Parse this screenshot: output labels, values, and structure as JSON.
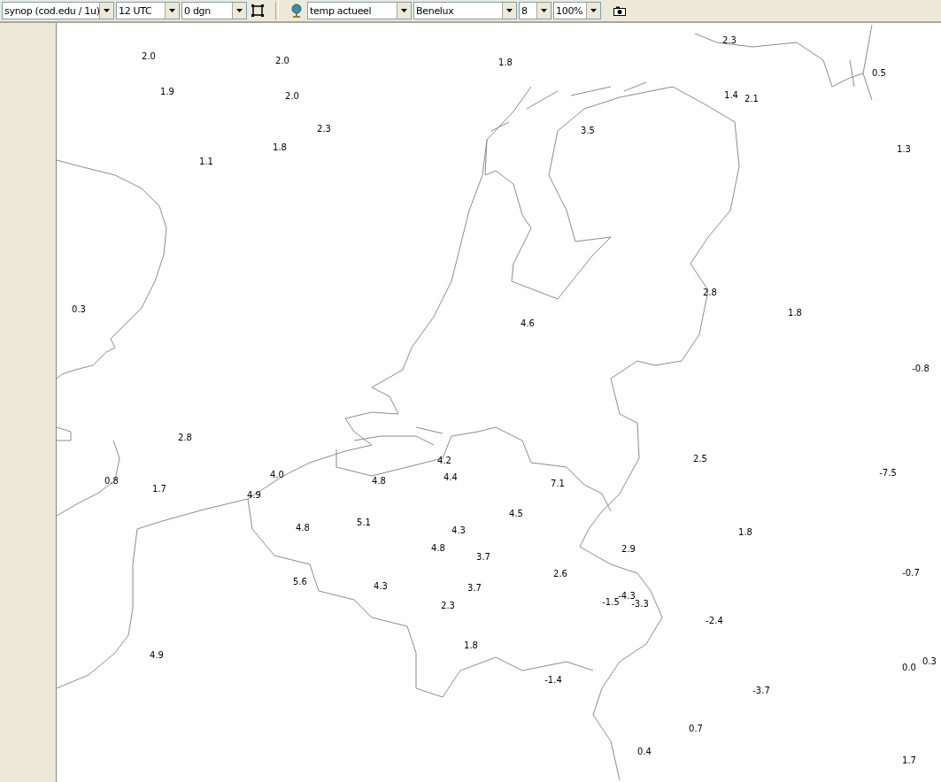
{
  "toolbar": {
    "left_dropdowns": [
      {
        "value": "synop (cod.edu / 1u)"
      },
      {
        "value": "12 UTC"
      },
      {
        "value": "0 dgn"
      }
    ],
    "right_dropdowns": [
      {
        "value": "temp actueel"
      },
      {
        "value": "Benelux"
      },
      {
        "value": "8"
      },
      {
        "value": "100%"
      }
    ]
  },
  "map": {
    "stations": [
      {
        "value": "2.3"
      },
      {
        "value": "2.0"
      },
      {
        "value": "2.0"
      },
      {
        "value": "1.8"
      },
      {
        "value": "0.5"
      },
      {
        "value": "1.9"
      },
      {
        "value": "2.0"
      },
      {
        "value": "1.4"
      },
      {
        "value": "2.1"
      },
      {
        "value": "2.3"
      },
      {
        "value": "3.5"
      },
      {
        "value": "1.8"
      },
      {
        "value": "1.3"
      },
      {
        "value": "1.1"
      },
      {
        "value": "0.3"
      },
      {
        "value": "2.8"
      },
      {
        "value": "1.8"
      },
      {
        "value": "4.6"
      },
      {
        "value": "-0.8"
      },
      {
        "value": "2.8"
      },
      {
        "value": "4.2"
      },
      {
        "value": "2.5"
      },
      {
        "value": "4.0"
      },
      {
        "value": "-7.5"
      },
      {
        "value": "4.4"
      },
      {
        "value": "0.8"
      },
      {
        "value": "4.8"
      },
      {
        "value": "7.1"
      },
      {
        "value": "1.7"
      },
      {
        "value": "4.9"
      },
      {
        "value": "4.5"
      },
      {
        "value": "5.1"
      },
      {
        "value": "4.8"
      },
      {
        "value": "4.3"
      },
      {
        "value": "1.8"
      },
      {
        "value": "4.8"
      },
      {
        "value": "2.9"
      },
      {
        "value": "3.7"
      },
      {
        "value": "2.6"
      },
      {
        "value": "-0.7"
      },
      {
        "value": "5.6"
      },
      {
        "value": "4.3"
      },
      {
        "value": "3.7"
      },
      {
        "value": "2.3"
      },
      {
        "value": "-1.5"
      },
      {
        "value": "-4.3"
      },
      {
        "value": "-3.3"
      },
      {
        "value": "-2.4"
      },
      {
        "value": "1.8"
      },
      {
        "value": "4.9"
      },
      {
        "value": "0.3"
      },
      {
        "value": "0.0"
      },
      {
        "value": "-1.4"
      },
      {
        "value": "-3.7"
      },
      {
        "value": "0.7"
      },
      {
        "value": "0.4"
      },
      {
        "value": "1.7"
      }
    ]
  }
}
